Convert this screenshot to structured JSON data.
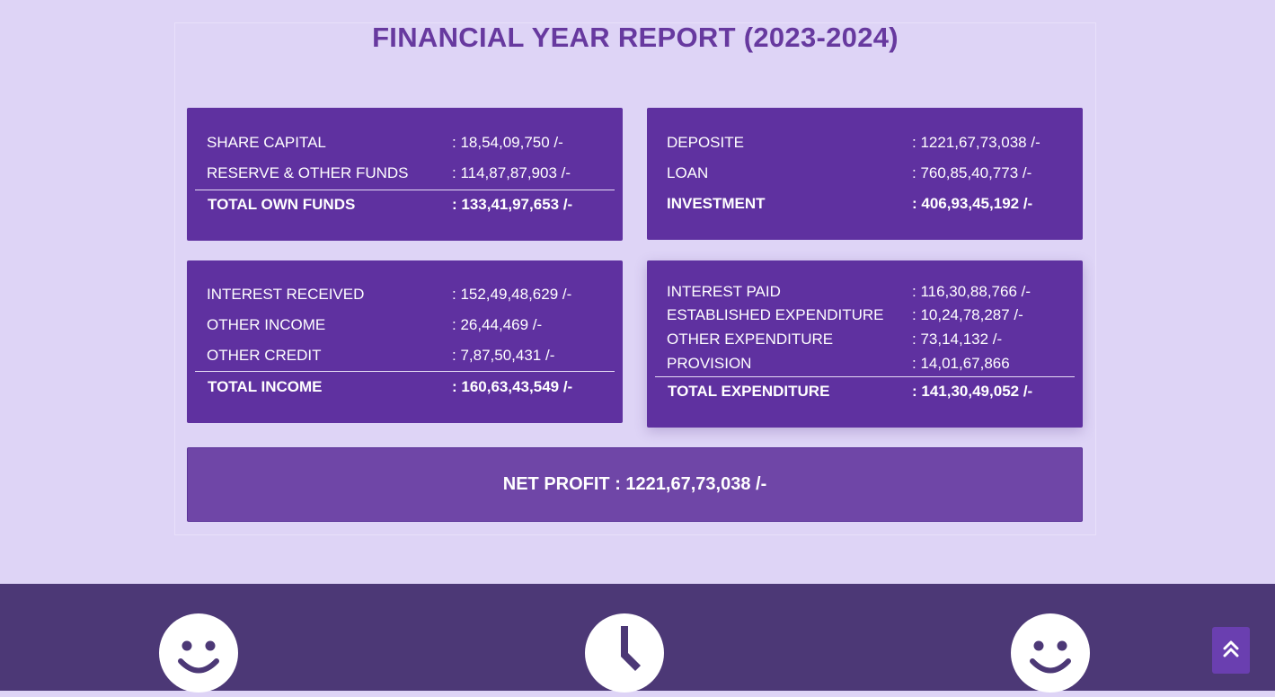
{
  "report": {
    "title": "FINANCIAL YEAR REPORT (2023-2024)",
    "own_funds": {
      "rows": [
        {
          "label": "SHARE CAPITAL",
          "value": ": 18,54,09,750 /-"
        },
        {
          "label": "RESERVE & OTHER FUNDS",
          "value": ": 114,87,87,903 /-"
        }
      ],
      "total": {
        "label": "TOTAL OWN FUNDS",
        "value": ": 133,41,97,653 /-"
      }
    },
    "deposits": {
      "rows": [
        {
          "label": "DEPOSITE",
          "value": ": 1221,67,73,038 /-"
        },
        {
          "label": "LOAN",
          "value": ": 760,85,40,773 /-"
        }
      ],
      "total": {
        "label": "INVESTMENT",
        "value": ": 406,93,45,192 /-"
      }
    },
    "income": {
      "rows": [
        {
          "label": "INTEREST RECEIVED",
          "value": ": 152,49,48,629 /-"
        },
        {
          "label": "OTHER INCOME",
          "value": ": 26,44,469 /-"
        },
        {
          "label": "OTHER CREDIT",
          "value": ": 7,87,50,431 /-"
        }
      ],
      "total": {
        "label": "TOTAL INCOME",
        "value": ": 160,63,43,549 /-"
      }
    },
    "expenditure": {
      "rows": [
        {
          "label": "INTEREST PAID",
          "value": ": 116,30,88,766 /-"
        },
        {
          "label": "ESTABLISHED EXPENDITURE",
          "value": ": 10,24,78,287 /-"
        },
        {
          "label": "OTHER EXPENDITURE",
          "value": ": 73,14,132 /-"
        },
        {
          "label": "PROVISION",
          "value": ": 14,01,67,866"
        }
      ],
      "total": {
        "label": "TOTAL EXPENDITURE",
        "value": ": 141,30,49,052 /-"
      }
    },
    "net_profit": "NET PROFIT : 1221,67,73,038 /-"
  },
  "footer": {
    "icons": [
      "smile-icon",
      "clock-icon",
      "smile-icon"
    ]
  },
  "scroll_top": {
    "icon": "double-chevron-up-icon"
  },
  "colors": {
    "background": "#ded4f6",
    "card": "#5f31a0",
    "title": "#67399f",
    "footer": "#4c3876"
  }
}
